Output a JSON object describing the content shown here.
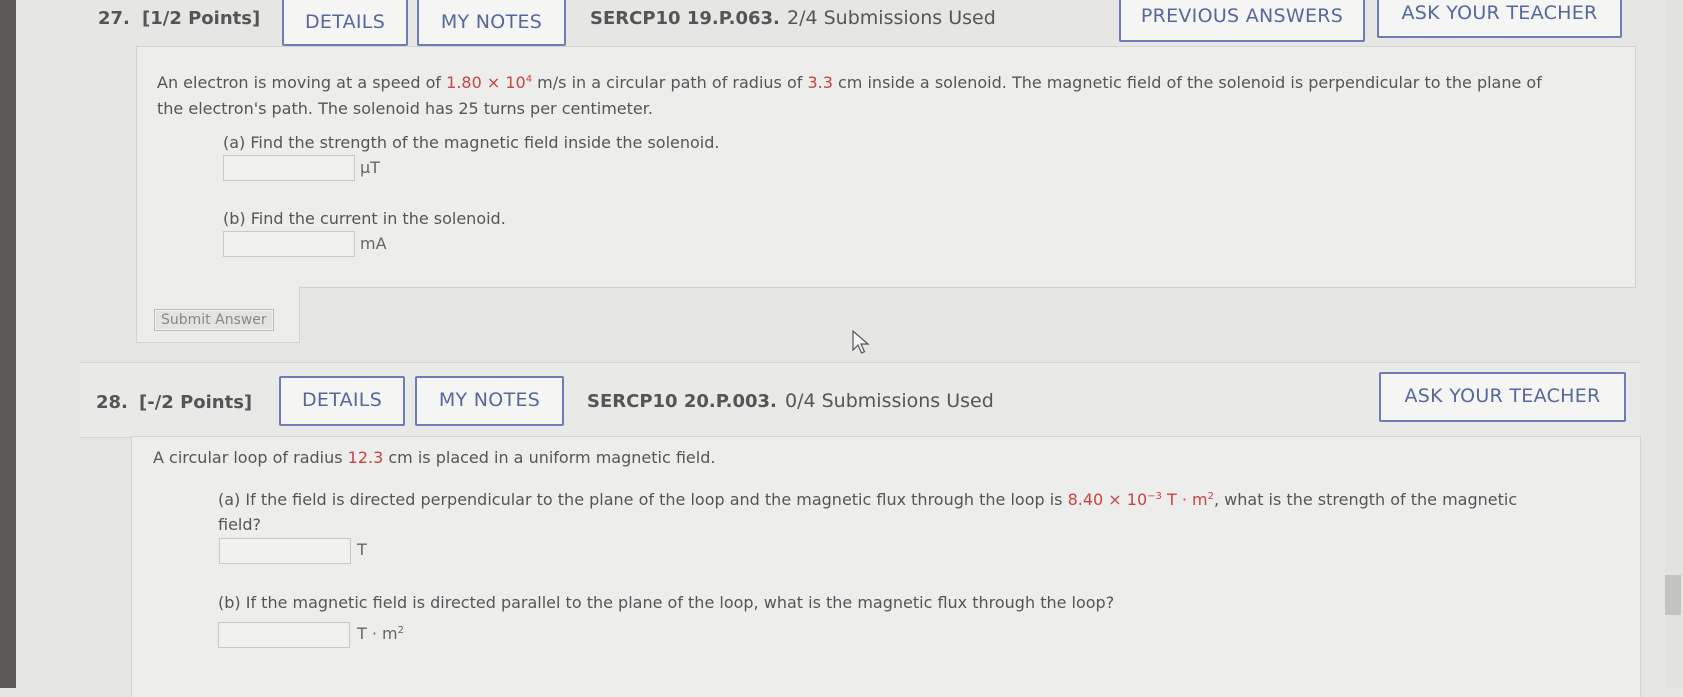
{
  "q27": {
    "number": "27.",
    "points": "[1/2 Points]",
    "details_label": "DETAILS",
    "notes_label": "MY NOTES",
    "code": "SERCP10 19.P.063.",
    "submissions": "2/4 Submissions Used",
    "prev_answers_label": "PREVIOUS ANSWERS",
    "ask_teacher_label": "ASK YOUR TEACHER",
    "text_part1": "An electron is moving at a speed of ",
    "speed_mantissa": "1.80 × 10",
    "speed_exp": "4",
    "text_part2": " m/s in a circular path of radius of ",
    "radius": "3.3",
    "text_part3": " cm inside a solenoid. The magnetic field of the solenoid is perpendicular to the plane of",
    "text_line2": "the electron's path. The solenoid has 25 turns per centimeter.",
    "a_prompt": "(a) Find the strength of the magnetic field inside the solenoid.",
    "a_unit": "μT",
    "b_prompt": "(b) Find the current in the solenoid.",
    "b_unit": "mA",
    "submit_label": "Submit Answer"
  },
  "q28": {
    "number": "28.",
    "points": "[-/2 Points]",
    "details_label": "DETAILS",
    "notes_label": "MY NOTES",
    "code": "SERCP10 20.P.003.",
    "submissions": "0/4 Submissions Used",
    "ask_teacher_label": "ASK YOUR TEACHER",
    "text_part1": "A circular loop of radius ",
    "radius": "12.3",
    "text_part2": " cm is placed in a uniform magnetic field.",
    "a_prompt_1": "(a) If the field is directed perpendicular to the plane of the loop and the magnetic flux through the loop is ",
    "flux_mantissa": "8.40 × 10",
    "flux_exp": "−3",
    "flux_unit": " T · m",
    "flux_unit_exp": "2",
    "a_prompt_2": ", what is the strength of the magnetic",
    "a_prompt_3": "field?",
    "a_unit": "T",
    "b_prompt": "(b) If the magnetic field is directed parallel to the plane of the loop, what is the magnetic flux through the loop?",
    "b_unit": "T · m",
    "b_unit_exp": "2"
  },
  "colors": {
    "button_text": "#56679c",
    "value_red": "#c64444"
  }
}
